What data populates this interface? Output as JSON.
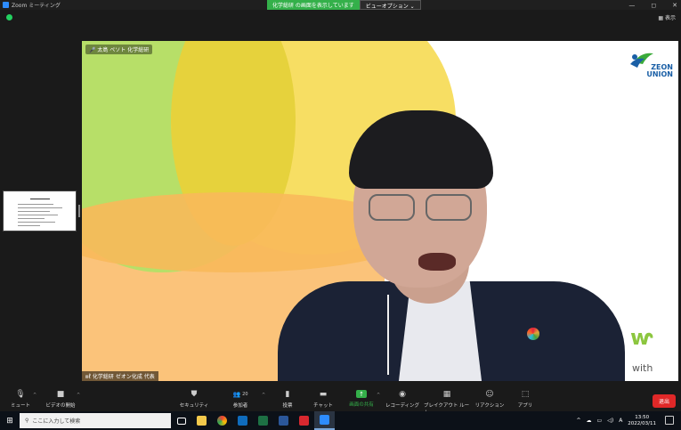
{
  "window": {
    "title": "Zoom ミーティング",
    "share_banner": "化学総研 の画面を表示しています",
    "view_options": "ビューオプション ⌄",
    "minimize": "—",
    "maximize": "◻",
    "close": "✕",
    "view_button": "▦ 表示"
  },
  "video": {
    "top_label": "🎤 太島 ペソト 化学総研",
    "name_label": "㎖ 化学総研 ゼオン化成 代表",
    "logo_text_top": "ZEON",
    "logo_text_bottom": "UNION",
    "with_mark": "ⱳ",
    "with_text": "with"
  },
  "toolbar": {
    "items": [
      {
        "label": "ミュート",
        "icon": "microphone-icon"
      },
      {
        "label": "ビデオの開始",
        "icon": "video-camera-icon"
      },
      {
        "label": "セキュリティ",
        "icon": "shield-icon"
      },
      {
        "label": "参加者",
        "icon": "participants-icon",
        "count": "20"
      },
      {
        "label": "投票",
        "icon": "poll-icon"
      },
      {
        "label": "チャット",
        "icon": "chat-icon"
      },
      {
        "label": "画面の共有",
        "icon": "share-screen-icon"
      },
      {
        "label": "レコーディング",
        "icon": "record-icon"
      },
      {
        "label": "ブレイクアウト ルーム",
        "icon": "breakout-icon"
      },
      {
        "label": "リアクション",
        "icon": "reaction-icon"
      },
      {
        "label": "アプリ",
        "icon": "apps-icon"
      }
    ],
    "leave": "退出"
  },
  "taskbar": {
    "search_placeholder": "ここに入力して検索",
    "time": "13:50",
    "date": "2022/03/11",
    "ime": "A"
  },
  "colors": {
    "accent_green": "#34b04a",
    "leave_red": "#e02828",
    "zoom_blue": "#2d8cff"
  }
}
